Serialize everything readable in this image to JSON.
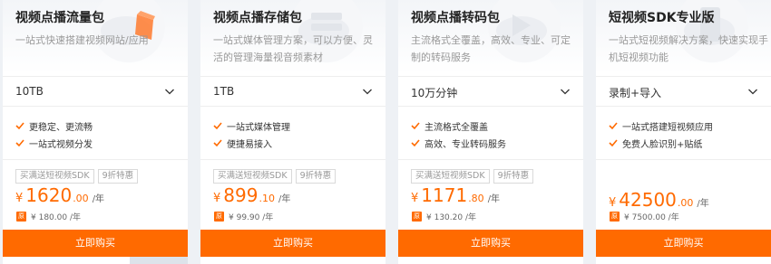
{
  "accent_color": "#ff6a00",
  "cards": [
    {
      "title": "视频点播流量包",
      "description": "一站式快速搭建视频网站/应用",
      "select_value": "10TB",
      "features": [
        "更稳定、更流畅",
        "一站式视频分发"
      ],
      "tags": [
        "买满送短视频SDK",
        "9折特惠"
      ],
      "price": {
        "currency": "¥",
        "integer": "1620",
        "decimal": ".00",
        "unit": "/年"
      },
      "original_price": "¥ 180.00 /年",
      "original_badge": "原",
      "buy_label": "立即购买"
    },
    {
      "title": "视频点播存储包",
      "description": "一站式媒体管理方案，可以方便、灵活的管理海量视音频素材",
      "select_value": "1TB",
      "features": [
        "一站式媒体管理",
        "便捷易接入"
      ],
      "tags": [
        "买满送短视频SDK",
        "9折特惠"
      ],
      "price": {
        "currency": "¥",
        "integer": "899",
        "decimal": ".10",
        "unit": "/年"
      },
      "original_price": "¥ 99.90 /年",
      "original_badge": "原",
      "buy_label": "立即购买"
    },
    {
      "title": "视频点播转码包",
      "description": "主流格式全覆盖，高效、专业、可定制的转码服务",
      "select_value": "10万分钟",
      "features": [
        "主流格式全覆盖",
        "高效、专业转码服务"
      ],
      "tags": [
        "买满送短视频SDK",
        "9折特惠"
      ],
      "price": {
        "currency": "¥",
        "integer": "1171",
        "decimal": ".80",
        "unit": "/年"
      },
      "original_price": "¥ 130.20 /年",
      "original_badge": "原",
      "buy_label": "立即购买"
    },
    {
      "title": "短视频SDK专业版",
      "description": "一站式短视频解决方案，快速实现手机短视频功能",
      "select_value": "录制+导入",
      "features": [
        "一站式搭建短视频应用",
        "免费人脸识别+贴纸"
      ],
      "tags": [],
      "price": {
        "currency": "¥",
        "integer": "42500",
        "decimal": ".00",
        "unit": "/年"
      },
      "original_price": "¥ 7500.00 /年",
      "original_badge": "原",
      "buy_label": "立即购买"
    }
  ]
}
